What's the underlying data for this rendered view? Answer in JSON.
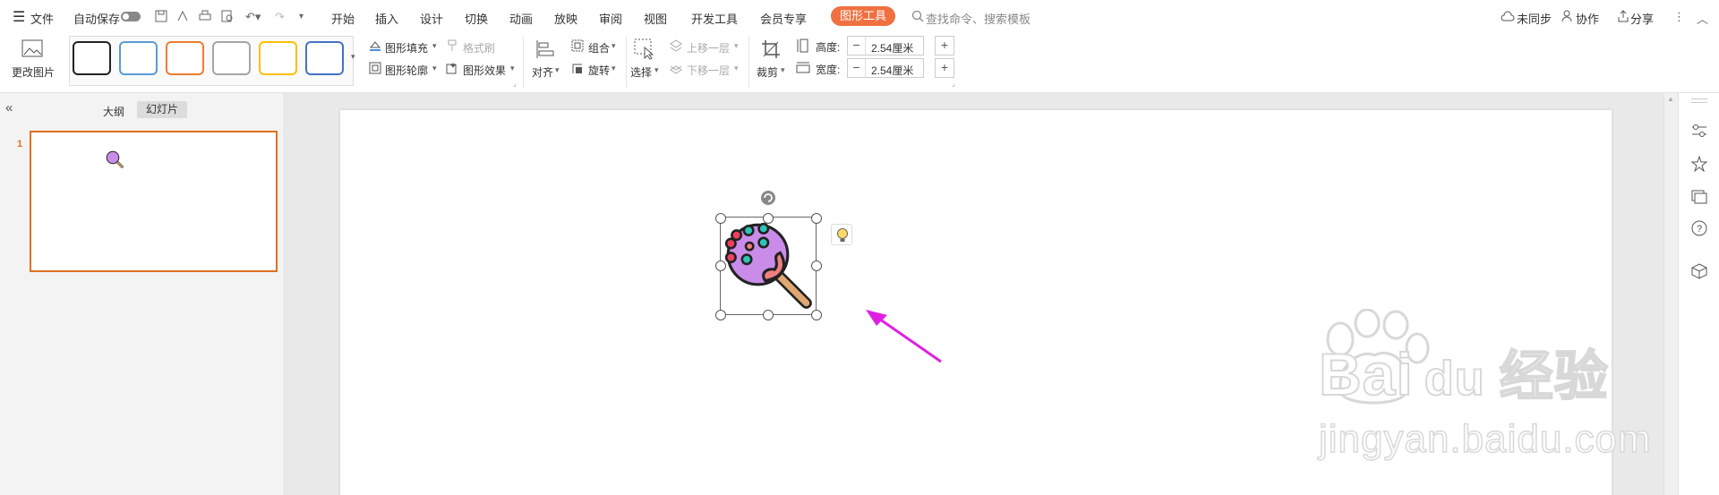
{
  "menubar": {
    "file_label": "文件",
    "autosave_label": "自动保存",
    "tabs": [
      "开始",
      "插入",
      "设计",
      "切换",
      "动画",
      "放映",
      "审阅",
      "视图",
      "开发工具",
      "会员专享"
    ],
    "active_tool_tab": "图形工具",
    "search_placeholder": "查找命令、搜索模板",
    "sync_label": "未同步",
    "collab_label": "协作",
    "share_label": "分享"
  },
  "toolbar": {
    "change_picture": "更改图片",
    "shape_styles": [
      {
        "name": "style-black",
        "color": "#222222"
      },
      {
        "name": "style-blue",
        "color": "#5b9bd5"
      },
      {
        "name": "style-orange",
        "color": "#ed7d31"
      },
      {
        "name": "style-gray",
        "color": "#a5a5a5"
      },
      {
        "name": "style-gold",
        "color": "#ffc000"
      },
      {
        "name": "style-darkblue",
        "color": "#4472c4"
      }
    ],
    "shape_fill": "图形填充",
    "format_painter": "格式刷",
    "shape_outline": "图形轮廓",
    "shape_effect": "图形效果",
    "align": "对齐",
    "group": "组合",
    "rotate": "旋转",
    "select": "选择",
    "bring_forward": "上移一层",
    "send_backward": "下移一层",
    "crop": "裁剪",
    "height_label": "高度:",
    "height_value": "2.54厘米",
    "width_label": "宽度:",
    "width_value": "2.54厘米",
    "minus": "−",
    "plus": "+"
  },
  "leftpanel": {
    "tab_outline": "大纲",
    "tab_slides": "幻灯片",
    "slide_number": "1"
  },
  "watermark": {
    "brand": "Bai",
    "brand2": "du",
    "cn": "经验",
    "url": "jingyan.baidu.com"
  },
  "colors": {
    "accent": "#f07040",
    "thumb_border": "#e07020",
    "arrow": "#e020e0",
    "selection": "#666666"
  }
}
